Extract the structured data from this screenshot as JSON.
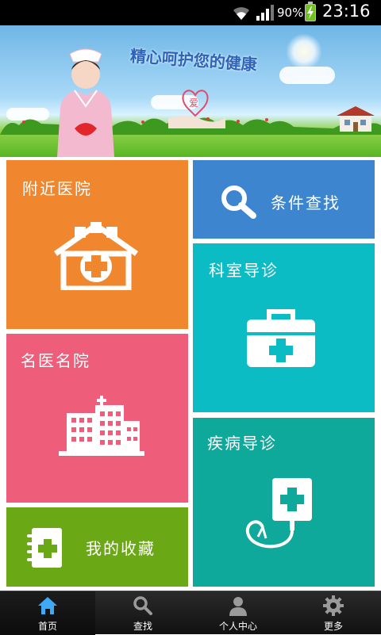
{
  "status_bar": {
    "battery_percent": "90%",
    "time": "23:16"
  },
  "banner": {
    "slogan": "精心呵护您的健康",
    "heart_text": "爱"
  },
  "tiles": {
    "nearby": {
      "label": "附近医院",
      "icon": "hospital-building-icon",
      "color": "#f0862d"
    },
    "search": {
      "label": "条件查找",
      "icon": "search-icon",
      "color": "#3e85d0"
    },
    "dept": {
      "label": "科室导诊",
      "icon": "medical-kit-icon",
      "color": "#0cbcc5"
    },
    "famous": {
      "label": "名医名院",
      "icon": "hospital-tower-icon",
      "color": "#ee5d7a"
    },
    "disease": {
      "label": "疾病导诊",
      "icon": "iv-drip-icon",
      "color": "#0ea99b"
    },
    "favorites": {
      "label": "我的收藏",
      "icon": "notebook-icon",
      "color": "#6ba815"
    }
  },
  "tabbar": {
    "tabs": [
      {
        "label": "首页",
        "icon": "home-icon",
        "active": true
      },
      {
        "label": "查找",
        "icon": "search-icon",
        "active": false
      },
      {
        "label": "个人中心",
        "icon": "person-icon",
        "active": false
      },
      {
        "label": "更多",
        "icon": "gear-icon",
        "active": false
      }
    ],
    "active_color": "#3fa9f5"
  }
}
